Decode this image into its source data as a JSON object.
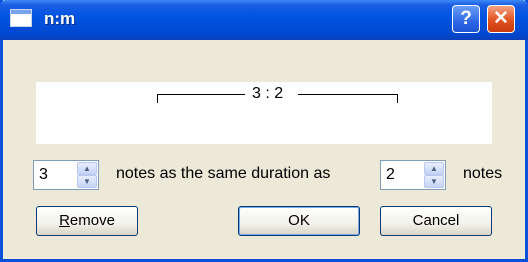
{
  "window": {
    "title": "n:m"
  },
  "titlebar": {
    "help_label": "?",
    "close_label": "✕"
  },
  "preview": {
    "ratio_text": "3 : 2"
  },
  "controls": {
    "n_value": "3",
    "m_value": "2",
    "middle_label": "notes as the same duration as",
    "end_label": "notes"
  },
  "buttons": {
    "remove": "Remove",
    "remove_mnemonic": "R",
    "remove_rest": "emove",
    "ok": "OK",
    "cancel": "Cancel"
  },
  "icons": {
    "window": "window-icon",
    "help": "help-icon",
    "close": "close-icon",
    "up": "spin-up-icon",
    "down": "spin-down-icon"
  }
}
